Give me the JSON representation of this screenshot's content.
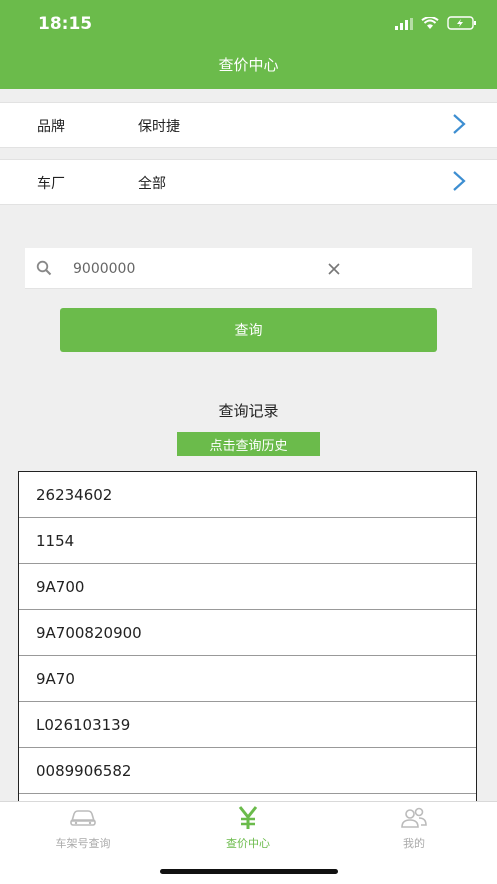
{
  "status_bar": {
    "time": "18:15"
  },
  "header": {
    "title": "查价中心"
  },
  "filters": [
    {
      "label": "品牌",
      "value": "保时捷"
    },
    {
      "label": "车厂",
      "value": "全部"
    }
  ],
  "search": {
    "value": "9000000"
  },
  "query_button": {
    "label": "查询"
  },
  "records_section": {
    "title": "查询记录",
    "history_button": "点击查询历史",
    "items": [
      "26234602",
      "1154",
      "9A700",
      "9A700820900",
      "9A70",
      "L026103139",
      "0089906582"
    ]
  },
  "tabbar": {
    "tabs": [
      {
        "label": "车架号查询",
        "icon": "car-icon"
      },
      {
        "label": "查价中心",
        "icon": "yen-icon"
      },
      {
        "label": "我的",
        "icon": "people-icon"
      }
    ]
  },
  "colors": {
    "accent": "#6bbb4b",
    "chevron": "#3d8ed1"
  }
}
